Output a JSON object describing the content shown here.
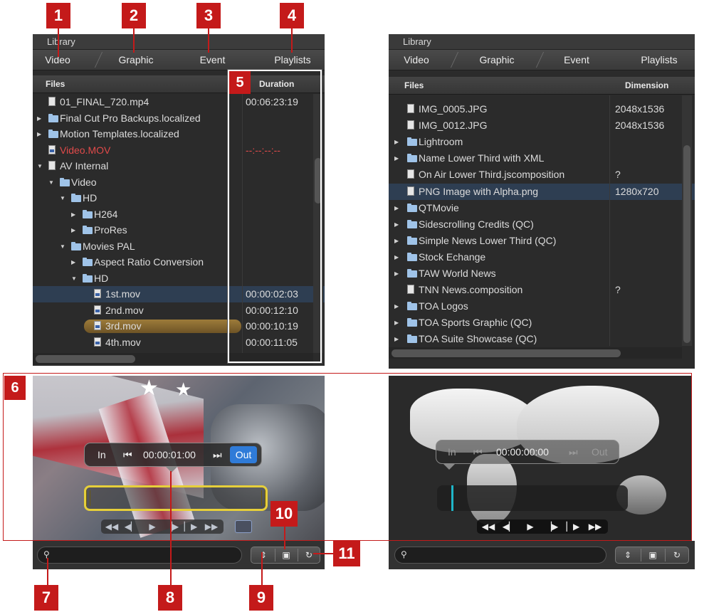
{
  "left": {
    "library_label": "Library",
    "tabs": [
      "Video",
      "Graphic",
      "Event",
      "Playlists"
    ],
    "col_files": "Files",
    "col_duration": "Duration",
    "rows": [
      {
        "name": "01_FINAL_720.mp4",
        "value": "00:06:23:19",
        "indent": 0,
        "kind": "file",
        "tri": ""
      },
      {
        "name": "Final Cut Pro Backups.localized",
        "value": "",
        "indent": 0,
        "kind": "folder",
        "tri": "▶"
      },
      {
        "name": "Motion Templates.localized",
        "value": "",
        "indent": 0,
        "kind": "folder",
        "tri": "▶"
      },
      {
        "name": "Video.MOV",
        "value": "--:--:--:--",
        "indent": 0,
        "kind": "mov",
        "tri": "",
        "red": true
      },
      {
        "name": "AV Internal",
        "value": "",
        "indent": 0,
        "kind": "file",
        "tri": "▼"
      },
      {
        "name": "Video",
        "value": "",
        "indent": 1,
        "kind": "folder",
        "tri": "▼"
      },
      {
        "name": "HD",
        "value": "",
        "indent": 2,
        "kind": "folder",
        "tri": "▼"
      },
      {
        "name": "H264",
        "value": "",
        "indent": 3,
        "kind": "folder",
        "tri": "▶"
      },
      {
        "name": "ProRes",
        "value": "",
        "indent": 3,
        "kind": "folder",
        "tri": "▶"
      },
      {
        "name": "Movies PAL",
        "value": "",
        "indent": 2,
        "kind": "folder",
        "tri": "▼"
      },
      {
        "name": "Aspect Ratio Conversion",
        "value": "",
        "indent": 3,
        "kind": "folder",
        "tri": "▶"
      },
      {
        "name": "HD",
        "value": "",
        "indent": 3,
        "kind": "folder",
        "tri": "▼"
      },
      {
        "name": "1st.mov",
        "value": "00:00:02:03",
        "indent": 4,
        "kind": "mov",
        "tri": "",
        "selected": true
      },
      {
        "name": "2nd.mov",
        "value": "00:00:12:10",
        "indent": 4,
        "kind": "mov",
        "tri": ""
      },
      {
        "name": "3rd.mov",
        "value": "00:00:10:19",
        "indent": 4,
        "kind": "mov",
        "tri": "",
        "highlight": true
      },
      {
        "name": "4th.mov",
        "value": "00:00:11:05",
        "indent": 4,
        "kind": "mov",
        "tri": ""
      }
    ],
    "in_label": "In",
    "timecode": "00:00:01:00",
    "out_label": "Out"
  },
  "right": {
    "library_label": "Library",
    "tabs": [
      "Video",
      "Graphic",
      "Event",
      "Playlists"
    ],
    "col_files": "Files",
    "col_dimension": "Dimension",
    "rows": [
      {
        "name": "IMG_0005.JPG",
        "value": "2048x1536",
        "kind": "file",
        "tri": ""
      },
      {
        "name": "IMG_0012.JPG",
        "value": "2048x1536",
        "kind": "file",
        "tri": ""
      },
      {
        "name": "Lightroom",
        "value": "",
        "kind": "folder",
        "tri": "▶"
      },
      {
        "name": "Name Lower Third with XML",
        "value": "",
        "kind": "folder",
        "tri": "▶"
      },
      {
        "name": "On Air Lower Third.jscomposition",
        "value": "?",
        "kind": "file",
        "tri": ""
      },
      {
        "name": "PNG Image with Alpha.png",
        "value": "1280x720",
        "kind": "file",
        "tri": "",
        "selected": true
      },
      {
        "name": "QTMovie",
        "value": "",
        "kind": "folder",
        "tri": "▶"
      },
      {
        "name": "Sidescrolling Credits (QC)",
        "value": "",
        "kind": "folder",
        "tri": "▶"
      },
      {
        "name": "Simple News Lower Third (QC)",
        "value": "",
        "kind": "folder",
        "tri": "▶"
      },
      {
        "name": "Stock Echange",
        "value": "",
        "kind": "folder",
        "tri": "▶"
      },
      {
        "name": "TAW World News",
        "value": "",
        "kind": "folder",
        "tri": "▶"
      },
      {
        "name": "TNN News.composition",
        "value": "?",
        "kind": "file",
        "tri": ""
      },
      {
        "name": "TOA Logos",
        "value": "",
        "kind": "folder",
        "tri": "▶"
      },
      {
        "name": "TOA Sports Graphic (QC)",
        "value": "",
        "kind": "folder",
        "tri": "▶"
      },
      {
        "name": "TOA Suite Showcase (QC)",
        "value": "",
        "kind": "folder",
        "tri": "▶"
      }
    ],
    "in_label": "In",
    "timecode": "00:00:00:00",
    "out_label": "Out"
  },
  "callouts": [
    "1",
    "2",
    "3",
    "4",
    "5",
    "6",
    "7",
    "8",
    "9",
    "10",
    "11"
  ],
  "colors": {
    "callout": "#c41a1a",
    "out_button": "#2f7bd8",
    "selection": "#2e3e52",
    "highlight": "#8a6a30",
    "red_text": "#e04a4a"
  }
}
